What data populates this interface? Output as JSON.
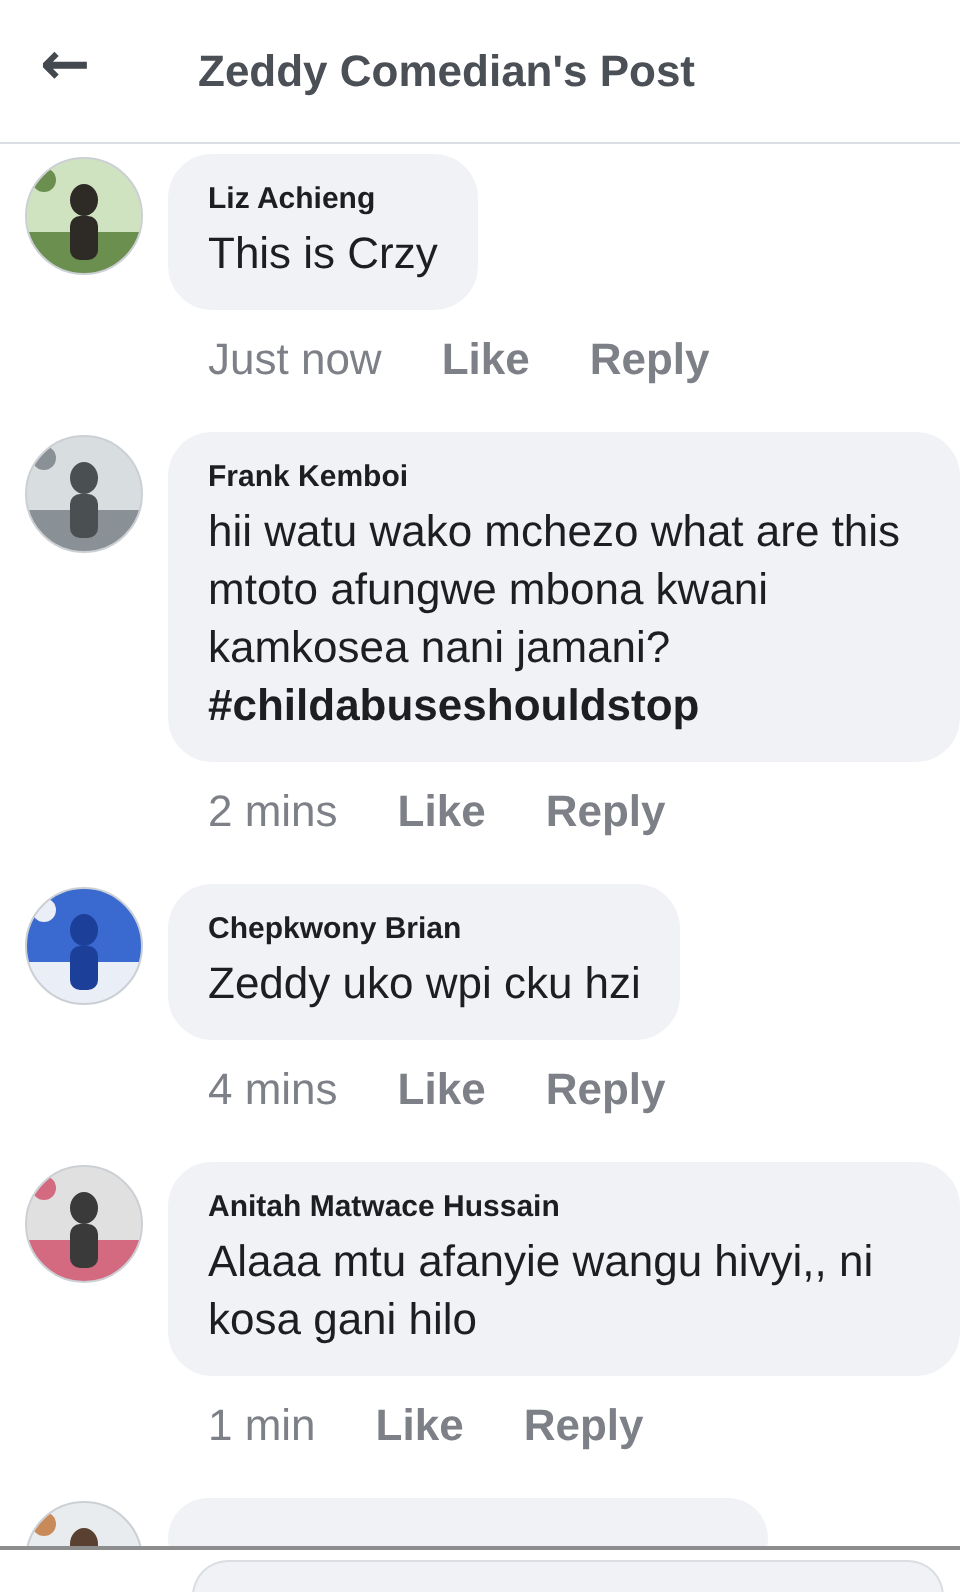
{
  "header": {
    "back": "←",
    "title": "Zeddy Comedian's Post"
  },
  "comments": [
    {
      "kind": "comment",
      "author": "Liz Achieng",
      "text": "This is Crzy",
      "time": "Just now",
      "like": "Like",
      "reply": "Reply"
    },
    {
      "kind": "comment",
      "author": "Frank Kemboi",
      "text": "hii watu wako mchezo what are this mtoto afungwe mbona kwani kamkosea nani jamani? **#childabuseshouldstop**",
      "time": "2 mins",
      "like": "Like",
      "reply": "Reply"
    },
    {
      "kind": "comment",
      "author": "Chepkwony Brian",
      "text": "Zeddy uko wpi cku hzi",
      "time": "4 mins",
      "like": "Like",
      "reply": "Reply"
    },
    {
      "kind": "comment",
      "author": "Anitah Matwace Hussain",
      "text": "Alaaa mtu afanyie wangu hivyi,, ni kosa gani hilo",
      "time": "1 min",
      "like": "Like",
      "reply": "Reply"
    },
    {
      "kind": "partial"
    }
  ]
}
